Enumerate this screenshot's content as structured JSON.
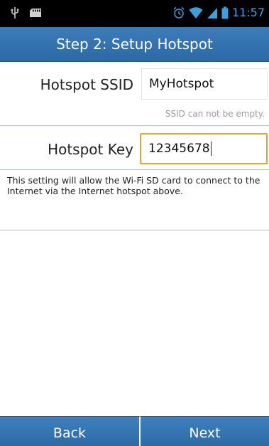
{
  "status_bar": {
    "left_icons": [
      "usb-icon",
      "sd-card-icon"
    ],
    "right_icons": [
      "alarm-icon",
      "wifi-icon",
      "signal-icon",
      "battery-icon"
    ],
    "time": "11:57",
    "accent_color": "#3aa0e0"
  },
  "title_bar": {
    "title": "Step 2: Setup Hotspot",
    "background_color": "#2f6eaa"
  },
  "form": {
    "ssid_label": "Hotspot SSID",
    "ssid_value": "MyHotspot",
    "ssid_hint": "SSID can not be empty.",
    "key_label": "Hotspot Key",
    "key_value": "12345678",
    "focus_color": "#f0a030"
  },
  "description": "This setting will allow the Wi-Fi SD card to connect to the Internet via the Internet hotspot above.",
  "buttons": {
    "back_label": "Back",
    "next_label": "Next"
  }
}
